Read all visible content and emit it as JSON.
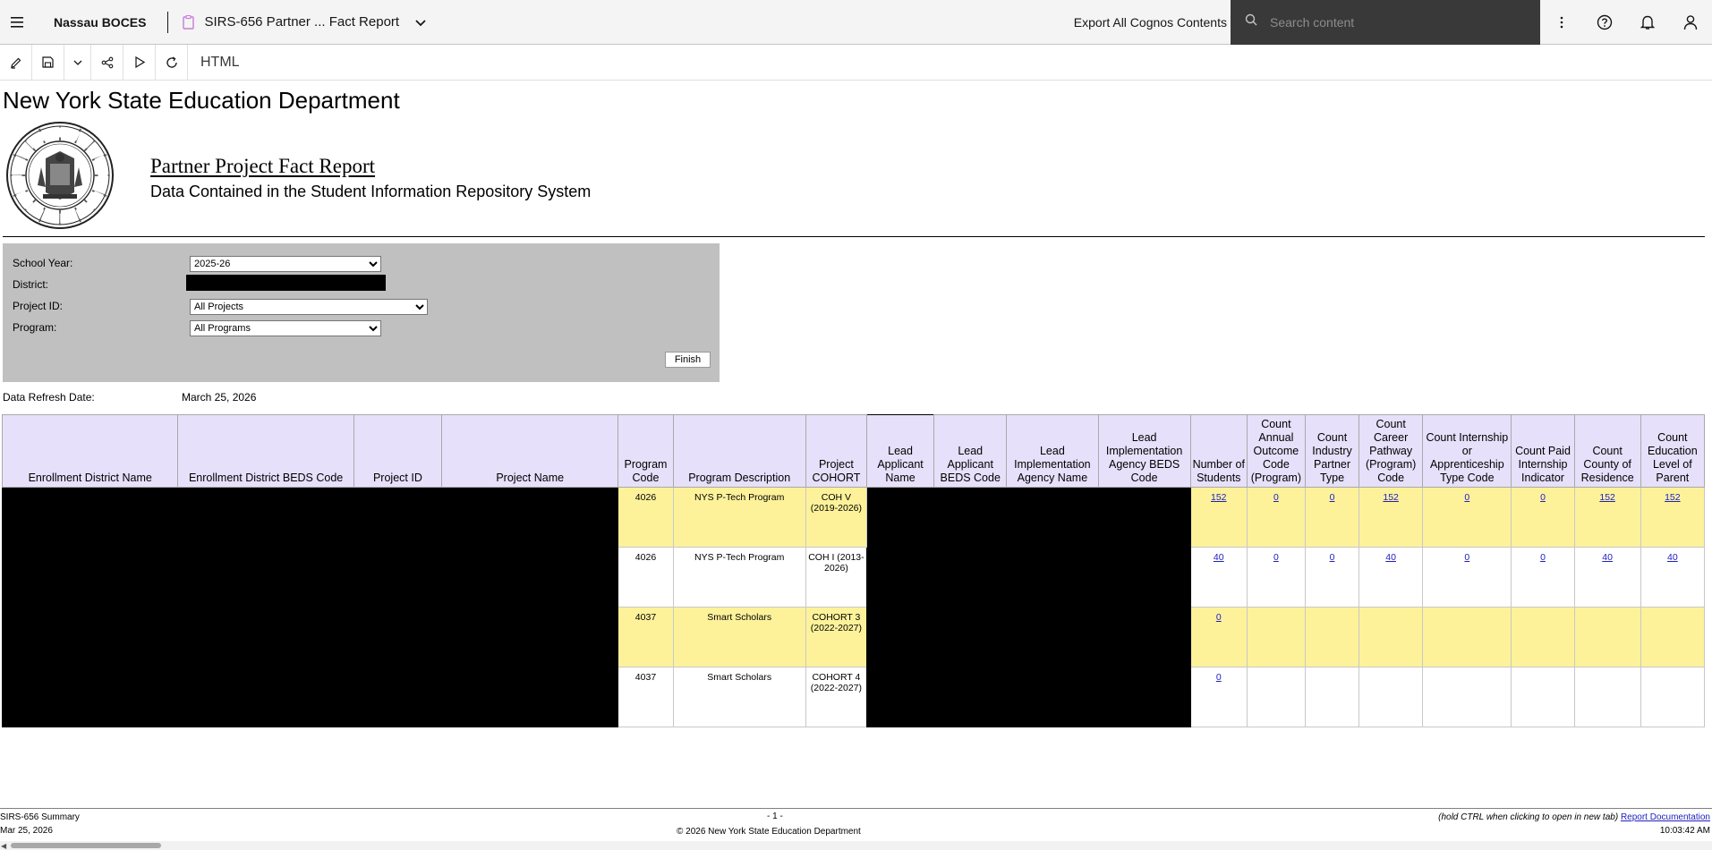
{
  "topbar": {
    "brand": "Nassau BOCES",
    "doc_title": "SIRS-656 Partner ... Fact Report",
    "export_label": "Export All Cognos Contents",
    "search_placeholder": "Search content"
  },
  "toolbar": {
    "view_label": "HTML"
  },
  "report": {
    "dept_title": "New York State Education Department",
    "title": "Partner Project Fact Report",
    "subtitle": "Data Contained in the Student Information Repository System",
    "prompts": {
      "school_year_label": "School Year:",
      "school_year_value": "2025-26",
      "district_label": "District:",
      "project_label": "Project ID:",
      "project_value": "All Projects",
      "program_label": "Program:",
      "program_value": "All Programs",
      "finish_label": "Finish"
    },
    "refresh_label": "Data Refresh Date:",
    "refresh_value": "March 25, 2026"
  },
  "table": {
    "headers": [
      "Enrollment District Name",
      "Enrollment District BEDS Code",
      "Project ID",
      "Project Name",
      "Program Code",
      "Program Description",
      "Project COHORT",
      "Lead Applicant Name",
      "Lead Applicant BEDS Code",
      "Lead Implementation Agency Name",
      "Lead Implementation Agency BEDS Code",
      "Number of Students",
      "Count Annual Outcome Code (Program)",
      "Count Industry Partner Type",
      "Count Career Pathway (Program) Code",
      "Count Internship or Apprenticeship Type Code",
      "Count Paid Internship Indicator",
      "Count County of Residence",
      "Count Education Level of Parent"
    ],
    "rows": [
      {
        "program_code": "4026",
        "program_desc": "NYS P-Tech Program",
        "cohort": "COH V (2019-2026)",
        "students": "152",
        "c1": "0",
        "c2": "0",
        "c3": "152",
        "c4": "0",
        "c5": "0",
        "c6": "152",
        "c7": "152"
      },
      {
        "program_code": "4026",
        "program_desc": "NYS P-Tech Program",
        "cohort": "COH I (2013-2026)",
        "students": "40",
        "c1": "0",
        "c2": "0",
        "c3": "40",
        "c4": "0",
        "c5": "0",
        "c6": "40",
        "c7": "40"
      },
      {
        "program_code": "4037",
        "program_desc": "Smart Scholars",
        "cohort": "COHORT 3 (2022-2027)",
        "students": "0",
        "c1": "",
        "c2": "",
        "c3": "",
        "c4": "",
        "c5": "",
        "c6": "",
        "c7": ""
      },
      {
        "program_code": "4037",
        "program_desc": "Smart Scholars",
        "cohort": "COHORT 4 (2022-2027)",
        "students": "0",
        "c1": "",
        "c2": "",
        "c3": "",
        "c4": "",
        "c5": "",
        "c6": "",
        "c7": ""
      }
    ]
  },
  "footer": {
    "report_name": "SIRS-656 Summary",
    "date": "Mar 25, 2026",
    "page": "- 1 -",
    "copyright": "© 2026 New York State Education Department",
    "hint": "(hold CTRL when clicking to open in new tab)",
    "doc_link": "Report Documentation",
    "time": "10:03:42 AM"
  },
  "icons": [
    "menu-icon",
    "report-icon",
    "chevron-down-icon",
    "search-icon",
    "overflow-icon",
    "help-icon",
    "notification-icon",
    "user-icon",
    "edit-icon",
    "save-icon",
    "share-icon",
    "run-icon",
    "refresh-icon"
  ]
}
